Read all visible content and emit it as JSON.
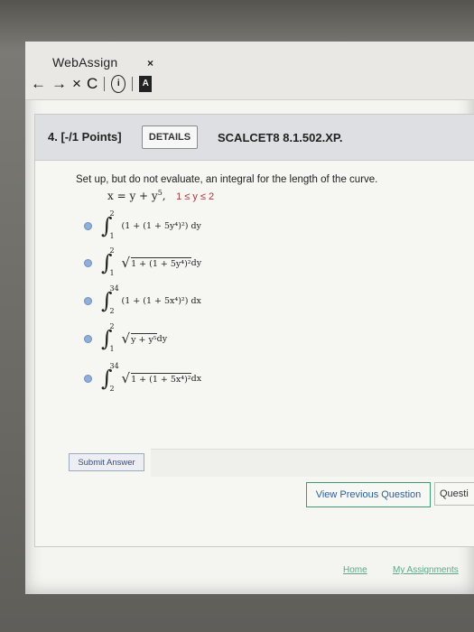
{
  "browser": {
    "tab_title": "WebAssign",
    "tab_close": "×",
    "nav": {
      "back": "←",
      "forward": "→",
      "close": "×",
      "reload": "C",
      "info": "i",
      "ext": "A"
    }
  },
  "question": {
    "number": "4. [-/1 Points]",
    "details_label": "DETAILS",
    "code": "SCALCET8 8.1.502.XP.",
    "prompt": "Set up, but do not evaluate, an integral for the length of the curve.",
    "equation": "x = y + y",
    "equation_exp": "5",
    "equation_cond": "1 ≤ y ≤ 2",
    "options": [
      {
        "upper": "2",
        "lower": "1",
        "body": "(1 + (1 + 5y⁴)²) dy",
        "sqrt": false
      },
      {
        "upper": "2",
        "lower": "1",
        "body": "1 + (1 + 5y⁴)²",
        "suffix": " dy",
        "sqrt": true
      },
      {
        "upper": "34",
        "lower": "2",
        "body": "(1 + (1 + 5x⁴)²) dx",
        "sqrt": false
      },
      {
        "upper": "2",
        "lower": "1",
        "body": "y + y⁵",
        "suffix": " dy",
        "sqrt": true
      },
      {
        "upper": "34",
        "lower": "2",
        "body": "1 + (1 + 5x⁴)²",
        "suffix": " dx",
        "sqrt": true
      }
    ],
    "submit_label": "Submit Answer"
  },
  "footer": {
    "view_previous": "View Previous Question",
    "question_link": "Questi",
    "home": "Home",
    "my_assignments": "My Assignments"
  }
}
